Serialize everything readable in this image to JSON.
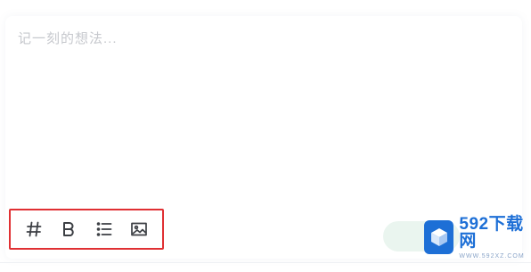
{
  "editor": {
    "placeholder": "记一刻的想法...",
    "value": ""
  },
  "toolbar": {
    "items": [
      {
        "name": "tag",
        "icon": "hash-icon"
      },
      {
        "name": "bold",
        "icon": "bold-icon"
      },
      {
        "name": "list",
        "icon": "list-icon"
      },
      {
        "name": "image",
        "icon": "image-icon"
      }
    ],
    "highlight_color": "#e03033"
  },
  "send_button": {
    "color": "#eaf5ef"
  },
  "watermark": {
    "title": "592下载网",
    "subtitle": "WWW.592XZ.COM",
    "brand_color": "#1d6fd6"
  }
}
